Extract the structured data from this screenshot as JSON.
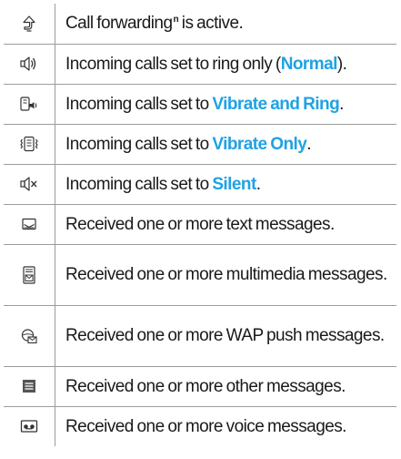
{
  "rows": [
    {
      "icon": "call-forwarding-icon",
      "text_before": "Call forwarding",
      "footnote": "n",
      "text_after": " is active."
    },
    {
      "icon": "ring-only-icon",
      "text_before": "Incoming calls set to ring only (",
      "mode": "Normal",
      "text_after": ")."
    },
    {
      "icon": "vibrate-and-ring-icon",
      "text_before": "Incoming calls set to ",
      "mode": "Vibrate and Ring",
      "text_after": "."
    },
    {
      "icon": "vibrate-only-icon",
      "text_before": "Incoming calls set to ",
      "mode": "Vibrate Only",
      "text_after": "."
    },
    {
      "icon": "silent-icon",
      "text_before": "Incoming calls set to ",
      "mode": "Silent",
      "text_after": "."
    },
    {
      "icon": "text-message-icon",
      "text": "Received one or more text messages."
    },
    {
      "icon": "multimedia-message-icon",
      "text": "Received one or more multimedia messages."
    },
    {
      "icon": "wap-push-message-icon",
      "text": "Received one or more WAP push messages."
    },
    {
      "icon": "other-message-icon",
      "text": "Received one or more other messages."
    },
    {
      "icon": "voice-message-icon",
      "text": "Received one or more voice messages."
    }
  ],
  "colors": {
    "mode_highlight": "#1fa2e3",
    "border": "#9c9c9c",
    "icon_stroke": "#333333"
  }
}
